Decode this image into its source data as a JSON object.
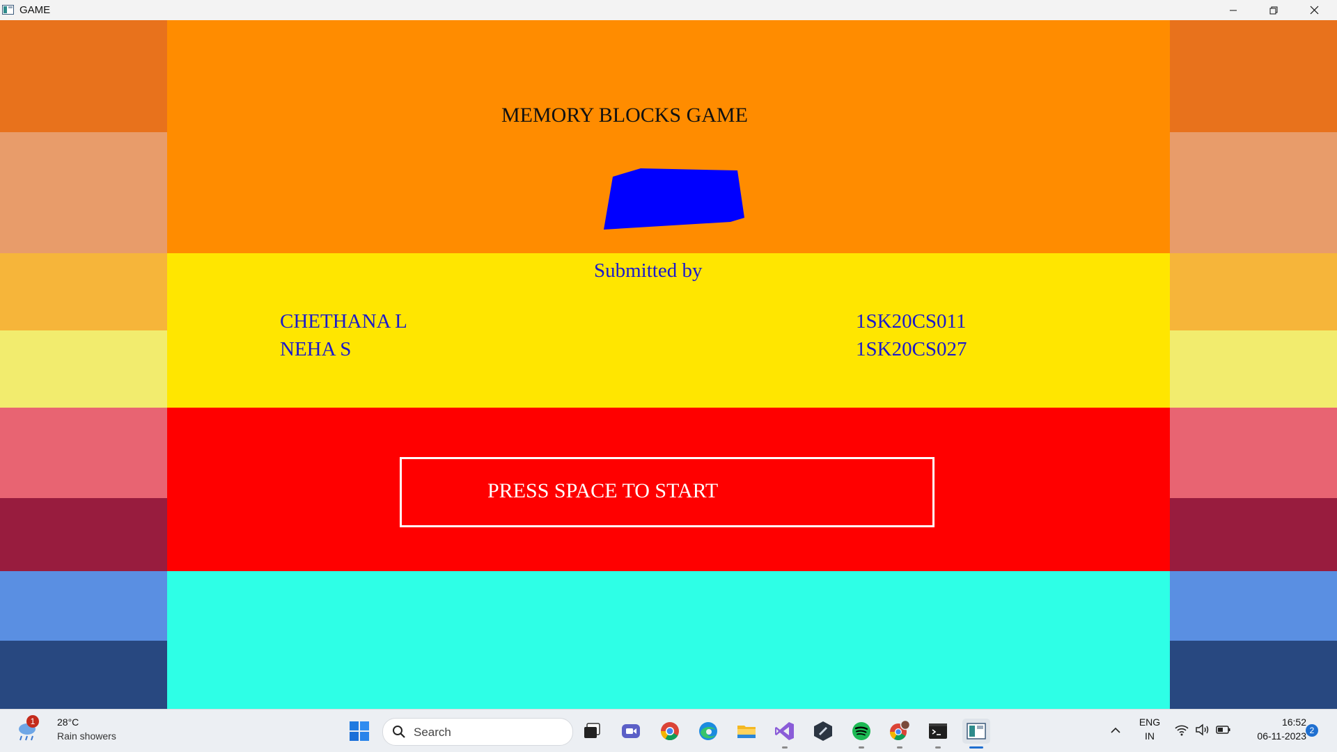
{
  "window": {
    "title": "GAME"
  },
  "game": {
    "title": "MEMORY BLOCKS GAME",
    "submitted_label": "Submitted by",
    "members": [
      {
        "name": "CHETHANA L",
        "usn": "1SK20CS011"
      },
      {
        "name": "NEHA S",
        "usn": "1SK20CS027"
      }
    ],
    "start_prompt": "PRESS SPACE TO START",
    "colors": {
      "band_orange": "#ff8c00",
      "band_yellow": "#ffe600",
      "band_red": "#ff0000",
      "band_cyan": "#2effe6",
      "block_blue": "#0000ff",
      "text_dark": "#111111",
      "text_blue": "#1a1acc",
      "text_white": "#ffffff",
      "side_1": "#e8721c",
      "side_2": "#e89c6a",
      "side_3": "#f6b53a",
      "side_4": "#f2ec6e",
      "side_5": "#e86472",
      "side_6": "#981c3e",
      "side_7": "#5a8fe2",
      "side_8": "#284880"
    }
  },
  "taskbar": {
    "weather": {
      "badge": "1",
      "temperature": "28°C",
      "condition": "Rain showers"
    },
    "search_placeholder": "Search",
    "pinned_apps": [
      "windows-start-icon",
      "task-view-icon",
      "teams-meet-icon",
      "chrome-icon",
      "edge-icon",
      "file-explorer-icon",
      "visual-studio-icon",
      "dark-app-icon",
      "spotify-icon",
      "chrome-profile-icon",
      "terminal-icon",
      "game-window-icon"
    ],
    "tray": {
      "language_top": "ENG",
      "language_bottom": "IN",
      "time": "16:52",
      "date": "06-11-2023",
      "notification_count": "2"
    }
  }
}
